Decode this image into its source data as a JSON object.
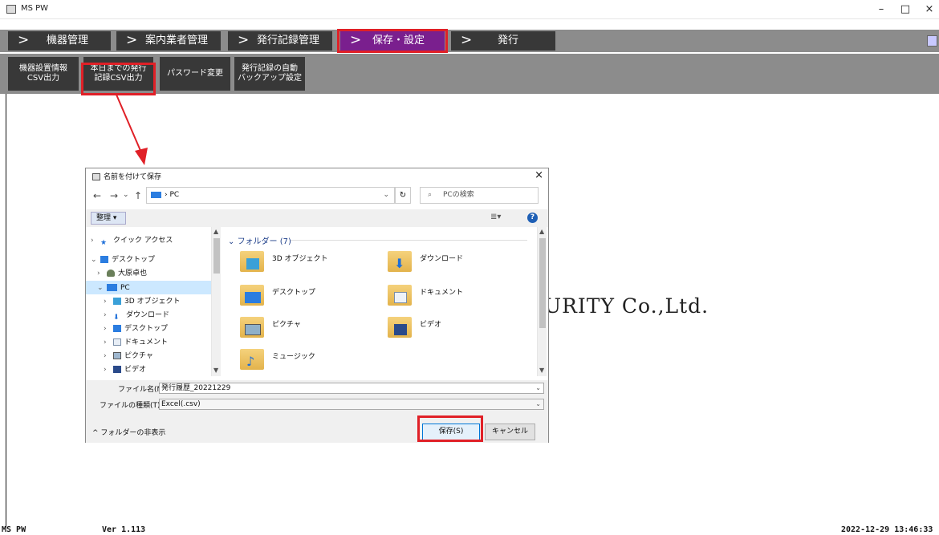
{
  "window": {
    "title": "MS PW",
    "minimize": "–",
    "maximize": "□",
    "close": "×"
  },
  "nav_tabs": [
    {
      "label": "機器管理",
      "active": false
    },
    {
      "label": "案内業者管理",
      "active": false
    },
    {
      "label": "発行記録管理",
      "active": false
    },
    {
      "label": "保存・設定",
      "active": true
    },
    {
      "label": "発行",
      "active": false
    }
  ],
  "sub_buttons": [
    {
      "label": "機器設置情報\nCSV出力"
    },
    {
      "label": "本日までの発行\n記録CSV出力"
    },
    {
      "label": "パスワード変更"
    },
    {
      "label": "発行記録の自動\nバックアップ設定"
    }
  ],
  "background_text": "URITY Co.,Ltd.",
  "status": {
    "app": "MS PW",
    "version": "Ver 1.113",
    "datetime": "2022-12-29 13:46:33"
  },
  "dialog": {
    "title": "名前を付けて保存",
    "close": "×",
    "nav": {
      "back": "←",
      "forward": "→",
      "recent": "⌄",
      "up": "↑"
    },
    "address": "PC",
    "address_sep": "›",
    "refresh": "↻",
    "search_placeholder": "PCの検索",
    "organize": "整理 ▾",
    "view": "≣▾",
    "help": "?",
    "tree": [
      {
        "label": "クイック アクセス",
        "arrow": "›"
      },
      {
        "label": "デスクトップ",
        "arrow": "⌄"
      },
      {
        "label": "大原卓也",
        "arrow": "›"
      },
      {
        "label": "PC",
        "arrow": "⌄"
      },
      {
        "label": "3D オブジェクト",
        "arrow": "›"
      },
      {
        "label": "ダウンロード",
        "arrow": "›"
      },
      {
        "label": "デスクトップ",
        "arrow": "›"
      },
      {
        "label": "ドキュメント",
        "arrow": "›"
      },
      {
        "label": "ピクチャ",
        "arrow": "›"
      },
      {
        "label": "ビデオ",
        "arrow": "›"
      }
    ],
    "folder_group": "フォルダー (7)",
    "folders": [
      {
        "label": "3D オブジェクト"
      },
      {
        "label": "ダウンロード"
      },
      {
        "label": "デスクトップ"
      },
      {
        "label": "ドキュメント"
      },
      {
        "label": "ピクチャ"
      },
      {
        "label": "ビデオ"
      },
      {
        "label": "ミュージック"
      }
    ],
    "filename_label": "ファイル名(N):",
    "filename_value": "発行履歴_20221229",
    "filetype_label": "ファイルの種類(T):",
    "filetype_value": "Excel(.csv)",
    "hide_folders": "フォルダーの非表示",
    "save_button": "保存(S)",
    "cancel_button": "キャンセル"
  },
  "colors": {
    "bar_gray": "#8c8c8c",
    "tab_dark": "#383838",
    "tab_active": "#7a1f8e",
    "highlight_red": "#e02027"
  }
}
